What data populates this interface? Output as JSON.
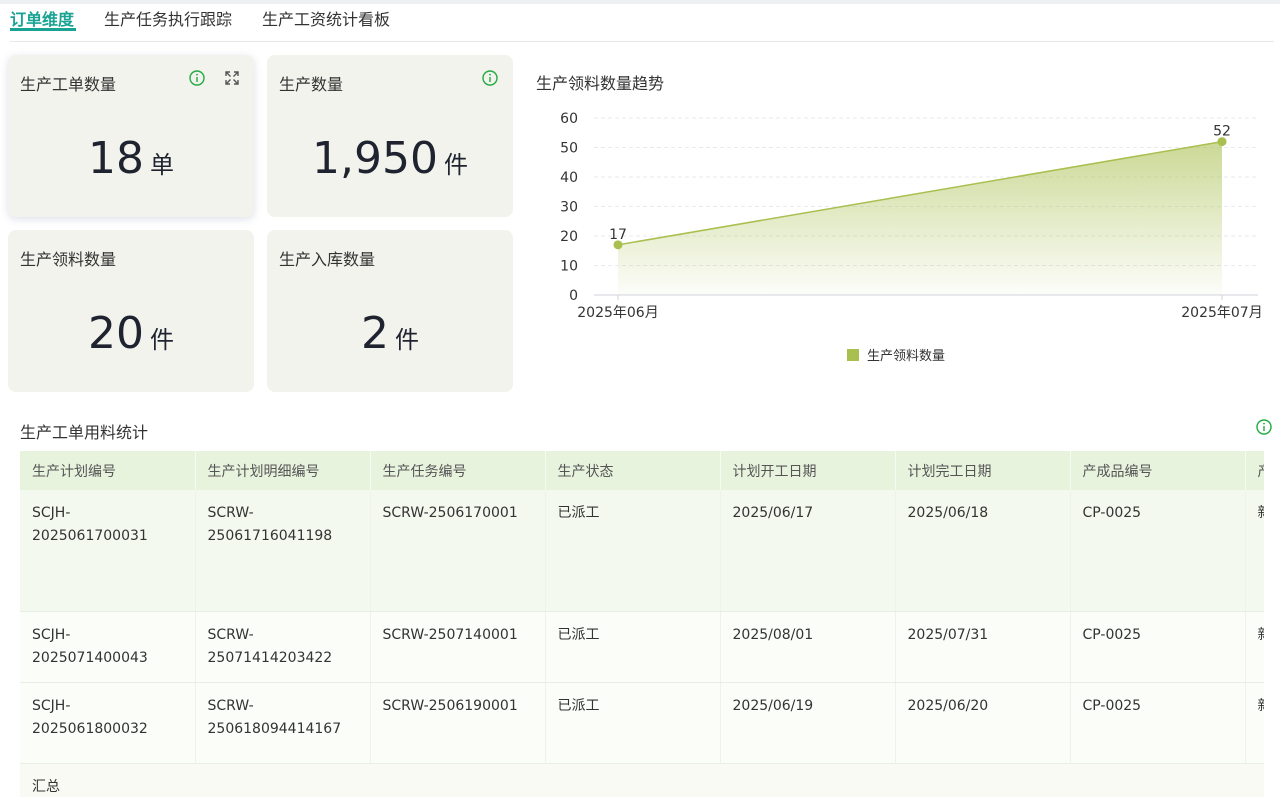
{
  "tabs": [
    {
      "label": "订单维度",
      "active": true
    },
    {
      "label": "生产任务执行跟踪",
      "active": false
    },
    {
      "label": "生产工资统计看板",
      "active": false
    }
  ],
  "kpis": [
    {
      "title": "生产工单数量",
      "value": "18",
      "unit": "单"
    },
    {
      "title": "生产数量",
      "value": "1,950",
      "unit": "件"
    },
    {
      "title": "生产领料数量",
      "value": "20",
      "unit": "件"
    },
    {
      "title": "生产入库数量",
      "value": "2",
      "unit": "件"
    }
  ],
  "colors": {
    "accent": "#1aa393",
    "series": "#a9bf4f",
    "info": "#22aa44"
  },
  "icons": {
    "info": "info-circle-icon",
    "expand": "expand-icon"
  },
  "chart_data": {
    "type": "area",
    "title": "生产领料数量趋势",
    "x": [
      "2025年06月",
      "2025年07月"
    ],
    "series": [
      {
        "name": "生产领料数量",
        "values": [
          17,
          52
        ]
      }
    ],
    "ylim": [
      0,
      60
    ],
    "yticks": [
      0,
      10,
      20,
      30,
      40,
      50,
      60
    ],
    "grid": true,
    "legend": "bottom"
  },
  "table": {
    "title": "生产工单用料统计",
    "columns": [
      "生产计划编号",
      "生产计划明细编号",
      "生产任务编号",
      "生产状态",
      "计划开工日期",
      "计划完工日期",
      "产成品编号",
      "产"
    ],
    "rows": [
      [
        "SCJH-2025061700031",
        "SCRW-25061716041198",
        "SCRW-2506170001",
        "已派工",
        "2025/06/17",
        "2025/06/18",
        "CP-0025",
        "新"
      ],
      [
        "SCJH-2025071400043",
        "SCRW-25071414203422",
        "SCRW-2507140001",
        "已派工",
        "2025/08/01",
        "2025/07/31",
        "CP-0025",
        "新"
      ],
      [
        "SCJH-2025061800032",
        "SCRW-250618094414167",
        "SCRW-2506190001",
        "已派工",
        "2025/06/19",
        "2025/06/20",
        "CP-0025",
        "新"
      ]
    ],
    "total_label": "汇总"
  }
}
